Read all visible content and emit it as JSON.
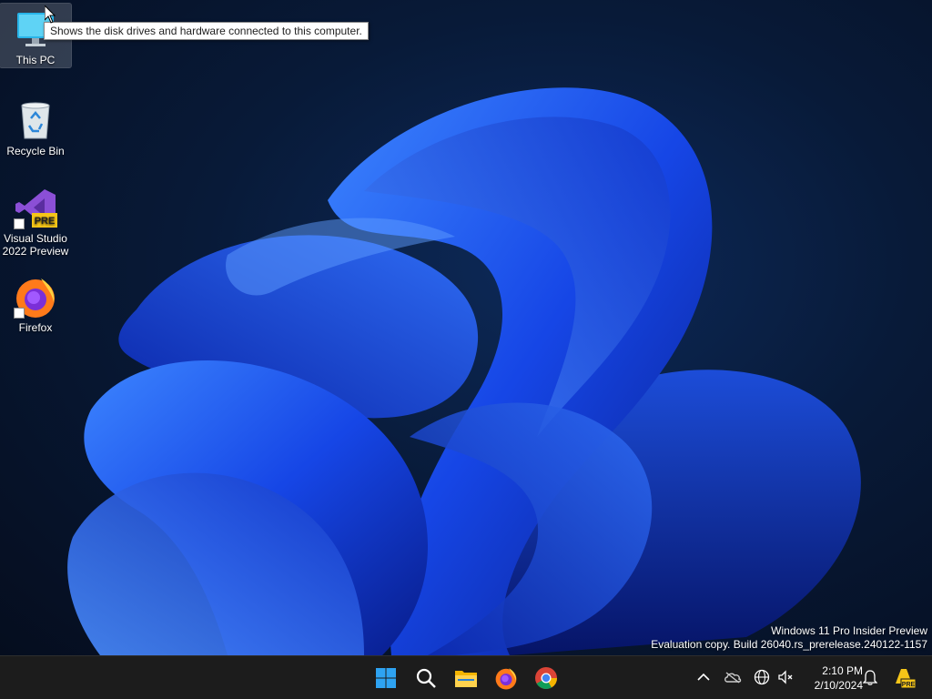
{
  "desktop": {
    "icons": [
      {
        "label": "This PC",
        "icon": "this-pc-icon"
      },
      {
        "label": "Recycle Bin",
        "icon": "recycle-bin-icon"
      },
      {
        "label": "Visual Studio 2022 Preview",
        "icon": "visual-studio-icon",
        "badge": "PRE"
      },
      {
        "label": "Firefox",
        "icon": "firefox-icon"
      }
    ],
    "tooltip": "Shows the disk drives and hardware connected to this computer.",
    "watermark": {
      "line1": "Windows 11 Pro Insider Preview",
      "line2": "Evaluation copy. Build 26040.rs_prerelease.240122-1157"
    }
  },
  "taskbar": {
    "pinned": [
      "start-icon",
      "search-icon",
      "file-explorer-icon",
      "firefox-icon",
      "chrome-icon"
    ],
    "tray": [
      "chevron-up-icon",
      "onedrive-icon",
      "network-icon",
      "volume-icon",
      "notification-bell-icon",
      "insider-pre-icon"
    ],
    "clock": {
      "time": "2:10 PM",
      "date": "2/10/2024"
    },
    "insider_badge": "PRE"
  },
  "colors": {
    "accent": "#1a5cff",
    "taskbar": "#1c1c1c"
  }
}
